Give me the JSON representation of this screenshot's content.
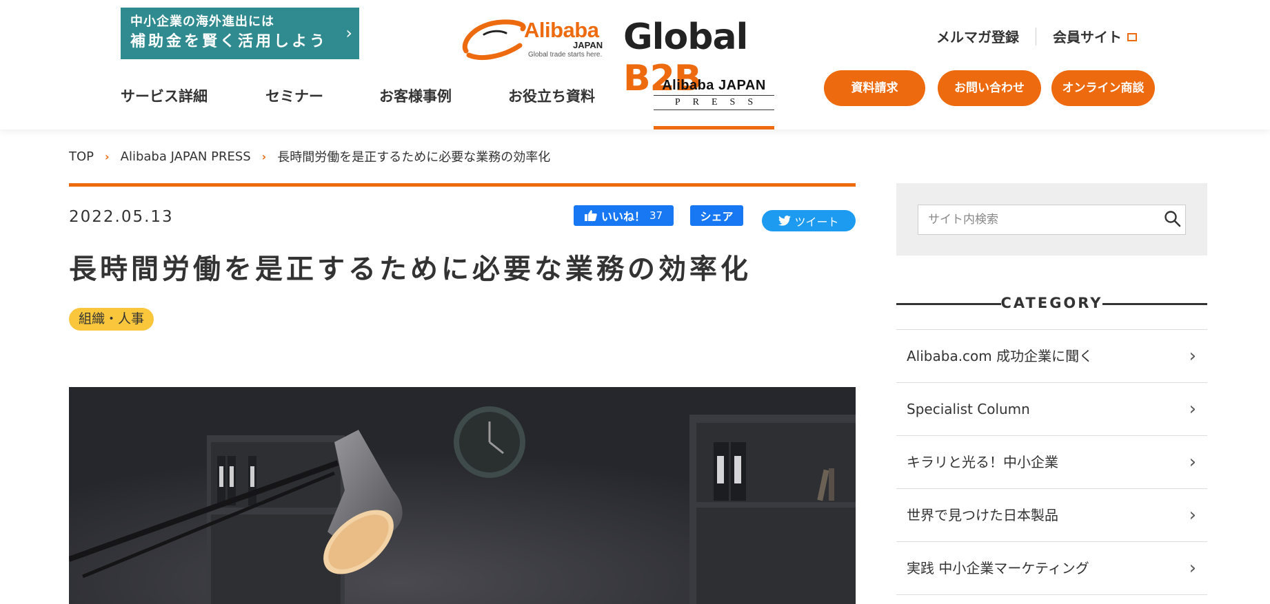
{
  "promo": {
    "line1": "中小企業の海外進出には",
    "line2": "補助金を賢く活用しよう",
    "chevron": "›"
  },
  "logo": {
    "alibaba": "Alibaba",
    "japan": "JAPAN",
    "tagline": "Global trade starts here.",
    "global": "Global ",
    "b2b": "B2B"
  },
  "toplinks": {
    "newsletter": "メルマガ登録",
    "member": "会員サイト"
  },
  "nav": {
    "items": [
      "サービス詳細",
      "セミナー",
      "お客様事例",
      "お役立ち資料"
    ],
    "press_line1": "Alibaba JAPAN",
    "press_line2": "PRESS"
  },
  "cta": {
    "request": "資料請求",
    "contact": "お問い合わせ",
    "online": "オンライン商談"
  },
  "breadcrumb": {
    "top": "TOP",
    "press": "Alibaba JAPAN PRESS",
    "current": "長時間労働を是正するために必要な業務の効率化",
    "sep": "›"
  },
  "article": {
    "date": "2022.05.13",
    "title": "長時間労働を是正するために必要な業務の効率化",
    "tag": "組織・人事"
  },
  "social": {
    "like_label": "いいね！",
    "like_count": "37",
    "share_label": "シェア",
    "tweet_label": "ツイート"
  },
  "sidebar": {
    "search_placeholder": "サイト内検索",
    "category_heading": "CATEGORY",
    "categories": [
      "Alibaba.com 成功企業に聞く",
      "Specialist Column",
      "キラリと光る！中小企業",
      "世界で見つけた日本製品",
      "実践 中小企業マーケティング"
    ],
    "chevron": "›"
  },
  "colors": {
    "accent": "#ee6a0f",
    "promo_bg": "#2f8b8f",
    "facebook": "#1877f2",
    "twitter": "#1d9bf0",
    "tag_yellow": "#f9c63c"
  }
}
